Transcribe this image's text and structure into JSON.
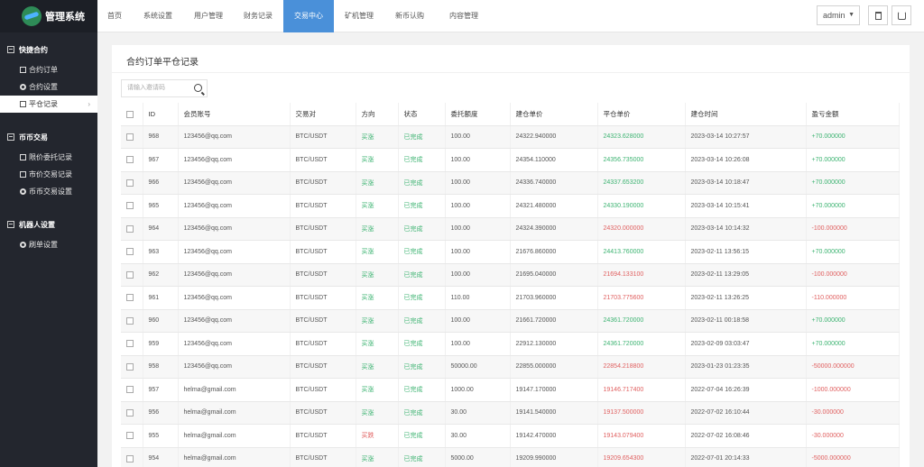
{
  "app": {
    "title": "管理系统"
  },
  "sidebar": {
    "groups": [
      {
        "title": "快捷合约",
        "items": [
          {
            "label": "合约订单",
            "icon": "list-icon"
          },
          {
            "label": "合约设置",
            "icon": "gear-icon"
          },
          {
            "label": "平仓记录",
            "icon": "list-icon",
            "active": true
          }
        ]
      },
      {
        "title": "币币交易",
        "items": [
          {
            "label": "限价委托记录",
            "icon": "list-icon"
          },
          {
            "label": "市价交易记录",
            "icon": "list-icon"
          },
          {
            "label": "币币交易设置",
            "icon": "gear-icon"
          }
        ]
      },
      {
        "title": "机器人设置",
        "items": [
          {
            "label": "刷单设置",
            "icon": "gear-icon"
          }
        ]
      }
    ]
  },
  "topnav": {
    "tabs": [
      "首页",
      "系统设置",
      "用户管理",
      "财务记录",
      "交易中心",
      "矿机管理",
      "新币认购",
      "内容管理"
    ],
    "active_index": 4,
    "user": "admin"
  },
  "page": {
    "title": "合约订单平仓记录",
    "search_placeholder": "请输入邀请码"
  },
  "table": {
    "headers": [
      "ID",
      "会员账号",
      "交易对",
      "方向",
      "状态",
      "委托额度",
      "建仓单价",
      "平仓单价",
      "建仓时间",
      "盈亏金额"
    ],
    "rows": [
      [
        "968",
        "123456@qq.com",
        "BTC/USDT",
        "买涨",
        "已完成",
        "100.00",
        "24322.940000",
        "24323.628000",
        "2023-03-14 10:27:57",
        "+70.000000"
      ],
      [
        "967",
        "123456@qq.com",
        "BTC/USDT",
        "买涨",
        "已完成",
        "100.00",
        "24354.110000",
        "24356.735000",
        "2023-03-14 10:26:08",
        "+70.000000"
      ],
      [
        "966",
        "123456@qq.com",
        "BTC/USDT",
        "买涨",
        "已完成",
        "100.00",
        "24336.740000",
        "24337.653200",
        "2023-03-14 10:18:47",
        "+70.000000"
      ],
      [
        "965",
        "123456@qq.com",
        "BTC/USDT",
        "买涨",
        "已完成",
        "100.00",
        "24321.480000",
        "24330.190000",
        "2023-03-14 10:15:41",
        "+70.000000"
      ],
      [
        "964",
        "123456@qq.com",
        "BTC/USDT",
        "买涨",
        "已完成",
        "100.00",
        "24324.390000",
        "24320.000000",
        "2023-03-14 10:14:32",
        "-100.000000"
      ],
      [
        "963",
        "123456@qq.com",
        "BTC/USDT",
        "买涨",
        "已完成",
        "100.00",
        "21676.860000",
        "24413.760000",
        "2023-02-11 13:56:15",
        "+70.000000"
      ],
      [
        "962",
        "123456@qq.com",
        "BTC/USDT",
        "买涨",
        "已完成",
        "100.00",
        "21695.040000",
        "21694.133100",
        "2023-02-11 13:29:05",
        "-100.000000"
      ],
      [
        "961",
        "123456@qq.com",
        "BTC/USDT",
        "买涨",
        "已完成",
        "110.00",
        "21703.960000",
        "21703.775600",
        "2023-02-11 13:26:25",
        "-110.000000"
      ],
      [
        "960",
        "123456@qq.com",
        "BTC/USDT",
        "买涨",
        "已完成",
        "100.00",
        "21661.720000",
        "24361.720000",
        "2023-02-11 00:18:58",
        "+70.000000"
      ],
      [
        "959",
        "123456@qq.com",
        "BTC/USDT",
        "买涨",
        "已完成",
        "100.00",
        "22912.130000",
        "24361.720000",
        "2023-02-09 03:03:47",
        "+70.000000"
      ],
      [
        "958",
        "123456@qq.com",
        "BTC/USDT",
        "买涨",
        "已完成",
        "50000.00",
        "22855.000000",
        "22854.218800",
        "2023-01-23 01:23:35",
        "-50000.000000"
      ],
      [
        "957",
        "helma@gmail.com",
        "BTC/USDT",
        "买涨",
        "已完成",
        "1000.00",
        "19147.170000",
        "19146.717400",
        "2022-07-04 16:26:39",
        "-1000.000000"
      ],
      [
        "956",
        "helma@gmail.com",
        "BTC/USDT",
        "买涨",
        "已完成",
        "30.00",
        "19141.540000",
        "19137.500000",
        "2022-07-02 16:10:44",
        "-30.000000"
      ],
      [
        "955",
        "helma@gmail.com",
        "BTC/USDT",
        "买跌",
        "已完成",
        "30.00",
        "19142.470000",
        "19143.079400",
        "2022-07-02 16:08:46",
        "-30.000000"
      ],
      [
        "954",
        "helma@gmail.com",
        "BTC/USDT",
        "买涨",
        "已完成",
        "5000.00",
        "19209.990000",
        "19209.654300",
        "2022-07-01 20:14:33",
        "-5000.000000"
      ]
    ]
  },
  "colors": {
    "accent": "#4a90d9",
    "sidebar_bg": "#23262e",
    "profit": "#3cb371",
    "loss": "#e06060"
  }
}
